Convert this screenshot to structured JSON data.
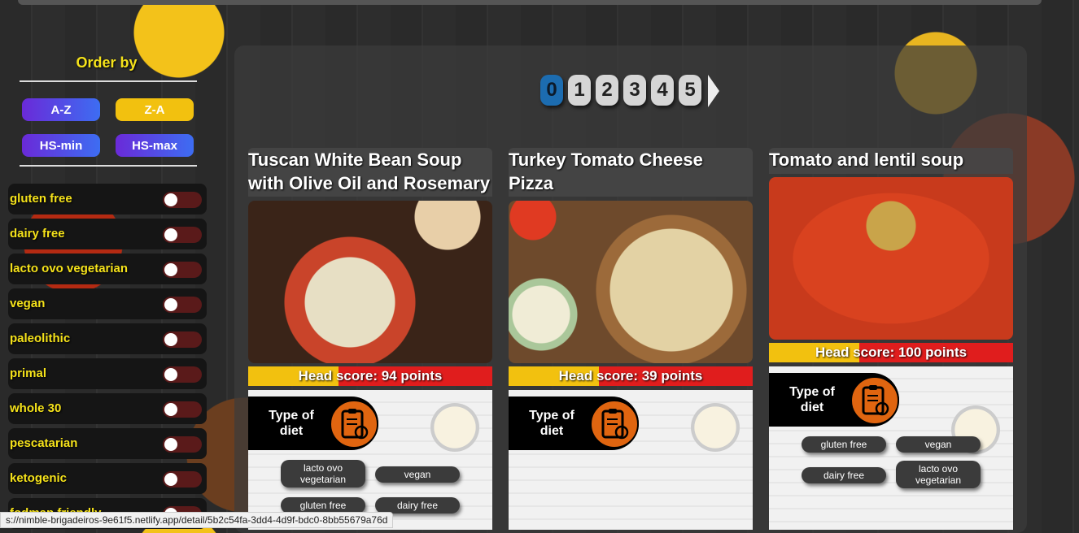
{
  "sidebar": {
    "order_title": "Order by",
    "sort_buttons": [
      "A-Z",
      "Z-A",
      "HS-min",
      "HS-max"
    ],
    "filters": [
      "gluten free",
      "dairy free",
      "lacto ovo vegetarian",
      "vegan",
      "paleolithic",
      "primal",
      "whole 30",
      "pescatarian",
      "ketogenic",
      "fodmap friendly"
    ]
  },
  "pagination": {
    "pages": [
      "0",
      "1",
      "2",
      "3",
      "4",
      "5"
    ],
    "active": "0"
  },
  "cards": [
    {
      "title_line1": "Tuscan White Bean Soup",
      "title_line2": "with Olive Oil and Rosemary",
      "score": "Head score: 94 points",
      "diet_label_1": "Type of",
      "diet_label_2": "diet",
      "tags": [
        "lacto ovo vegetarian",
        "vegan",
        "gluten free",
        "dairy free"
      ]
    },
    {
      "title_line1": "Turkey Tomato Cheese",
      "title_line2": "Pizza",
      "score": "Head score: 39 points",
      "diet_label_1": "Type of",
      "diet_label_2": "diet",
      "tags": []
    },
    {
      "title_line1": "Tomato and lentil soup",
      "score": "Head score: 100 points",
      "diet_label_1": "Type of",
      "diet_label_2": "diet",
      "tags": [
        "gluten free",
        "vegan",
        "dairy free",
        "lacto ovo vegetarian"
      ]
    }
  ],
  "status_bar": {
    "url": "s://nimble-brigadeiros-9e61f5.netlify.app/detail/5b2c54fa-3dd4-4d9f-bdc0-8bb55679a76d"
  },
  "colors": {
    "accent_yellow": "#f5e21a",
    "score_red": "#e01d1d",
    "score_yellow": "#f2c10f",
    "diet_orange": "#e06510"
  }
}
